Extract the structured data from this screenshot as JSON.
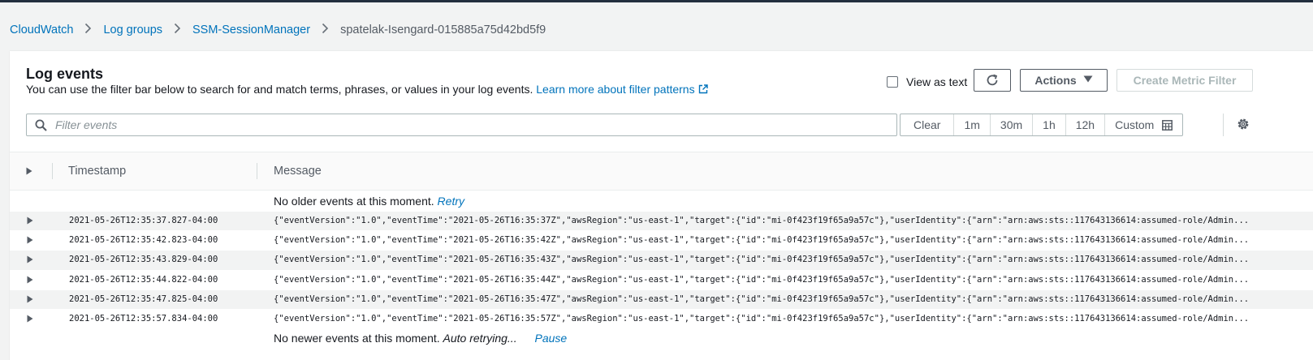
{
  "breadcrumb": {
    "items": [
      "CloudWatch",
      "Log groups",
      "SSM-SessionManager"
    ],
    "current": "spatelak-Isengard-015885a75d42bd5f9"
  },
  "panel": {
    "title": "Log events",
    "description": "You can use the filter bar below to search for and match terms, phrases, or values in your log events.",
    "learn_more": "Learn more about filter patterns",
    "view_as_text": "View as text",
    "actions_label": "Actions",
    "create_metric_filter": "Create Metric Filter"
  },
  "filter": {
    "placeholder": "Filter events",
    "time_options": [
      "Clear",
      "1m",
      "30m",
      "1h",
      "12h"
    ],
    "custom_label": "Custom"
  },
  "table": {
    "headers": {
      "timestamp": "Timestamp",
      "message": "Message"
    },
    "no_older": "No older events at this moment.",
    "retry": "Retry",
    "no_newer": "No newer events at this moment.",
    "auto_retrying": "Auto retrying...",
    "pause": "Pause",
    "rows": [
      {
        "ts": "2021-05-26T12:35:37.827-04:00",
        "msg": "{\"eventVersion\":\"1.0\",\"eventTime\":\"2021-05-26T16:35:37Z\",\"awsRegion\":\"us-east-1\",\"target\":{\"id\":\"mi-0f423f19f65a9a57c\"},\"userIdentity\":{\"arn\":\"arn:aws:sts::117643136614:assumed-role/Admin..."
      },
      {
        "ts": "2021-05-26T12:35:42.823-04:00",
        "msg": "{\"eventVersion\":\"1.0\",\"eventTime\":\"2021-05-26T16:35:42Z\",\"awsRegion\":\"us-east-1\",\"target\":{\"id\":\"mi-0f423f19f65a9a57c\"},\"userIdentity\":{\"arn\":\"arn:aws:sts::117643136614:assumed-role/Admin..."
      },
      {
        "ts": "2021-05-26T12:35:43.829-04:00",
        "msg": "{\"eventVersion\":\"1.0\",\"eventTime\":\"2021-05-26T16:35:43Z\",\"awsRegion\":\"us-east-1\",\"target\":{\"id\":\"mi-0f423f19f65a9a57c\"},\"userIdentity\":{\"arn\":\"arn:aws:sts::117643136614:assumed-role/Admin..."
      },
      {
        "ts": "2021-05-26T12:35:44.822-04:00",
        "msg": "{\"eventVersion\":\"1.0\",\"eventTime\":\"2021-05-26T16:35:44Z\",\"awsRegion\":\"us-east-1\",\"target\":{\"id\":\"mi-0f423f19f65a9a57c\"},\"userIdentity\":{\"arn\":\"arn:aws:sts::117643136614:assumed-role/Admin..."
      },
      {
        "ts": "2021-05-26T12:35:47.825-04:00",
        "msg": "{\"eventVersion\":\"1.0\",\"eventTime\":\"2021-05-26T16:35:47Z\",\"awsRegion\":\"us-east-1\",\"target\":{\"id\":\"mi-0f423f19f65a9a57c\"},\"userIdentity\":{\"arn\":\"arn:aws:sts::117643136614:assumed-role/Admin..."
      },
      {
        "ts": "2021-05-26T12:35:57.834-04:00",
        "msg": "{\"eventVersion\":\"1.0\",\"eventTime\":\"2021-05-26T16:35:57Z\",\"awsRegion\":\"us-east-1\",\"target\":{\"id\":\"mi-0f423f19f65a9a57c\"},\"userIdentity\":{\"arn\":\"arn:aws:sts::117643136614:assumed-role/Admin..."
      }
    ]
  }
}
